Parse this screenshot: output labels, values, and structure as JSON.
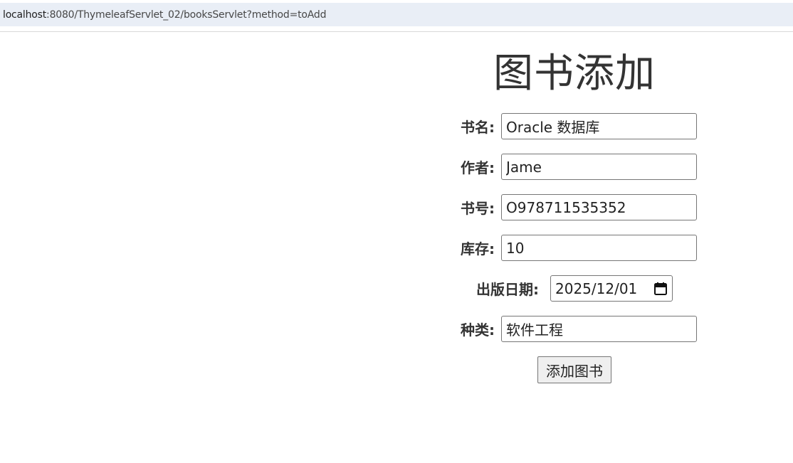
{
  "browser": {
    "url_host": "localhost",
    "url_path": ":8080/ThymeleafServlet_02/booksServlet?method=toAdd"
  },
  "page": {
    "title": "图书添加"
  },
  "form": {
    "name_label": "书名:",
    "name_value": "Oracle 数据库",
    "author_label": "作者:",
    "author_value": "Jame",
    "isbn_label": "书号:",
    "isbn_value": "O978711535352",
    "stock_label": "库存:",
    "stock_value": "10",
    "date_label": "出版日期:",
    "date_value": "2025/12/01",
    "date_icon": "calendar-icon",
    "category_label": "种类:",
    "category_value": "软件工程",
    "submit_label": "添加图书"
  }
}
